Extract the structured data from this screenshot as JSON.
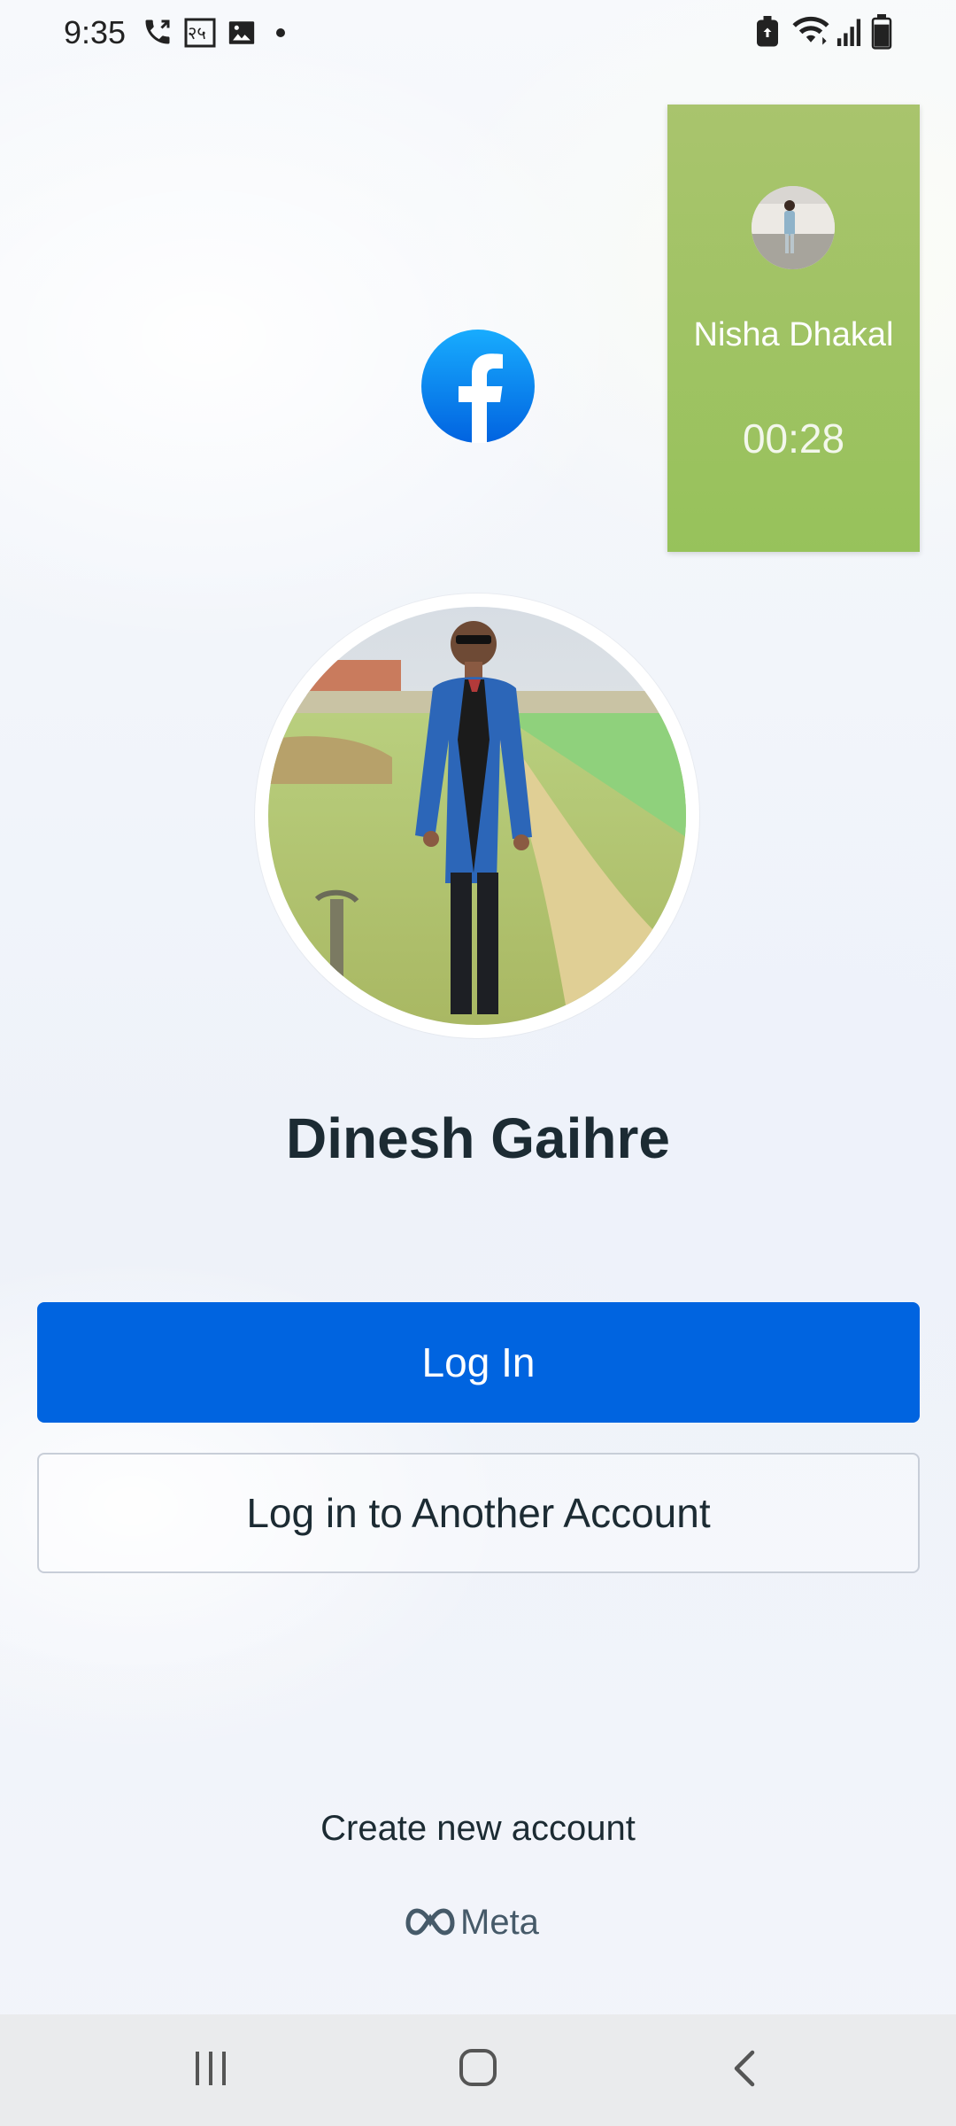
{
  "status_bar": {
    "time": "9:35",
    "left_icons": [
      "phone-call-icon",
      "nepali-calendar-icon",
      "gallery-icon",
      "notification-dot-icon"
    ],
    "calendar_label": "२५",
    "right_icons": [
      "battery-saver-icon",
      "wifi-icon",
      "signal-icon",
      "battery-icon"
    ]
  },
  "call_bubble": {
    "name": "Nisha Dhakal",
    "duration": "00:28",
    "background": "#9cc25f"
  },
  "login": {
    "app_icon": "facebook-logo-icon",
    "profile_name": "Dinesh Gaihre",
    "log_in_label": "Log In",
    "another_account_label": "Log in to Another Account",
    "create_account_label": "Create new account",
    "footer_brand": "Meta",
    "accent_color": "#0064e0"
  },
  "nav_bar": {
    "buttons": [
      "recent-apps-icon",
      "home-icon",
      "back-icon"
    ]
  }
}
